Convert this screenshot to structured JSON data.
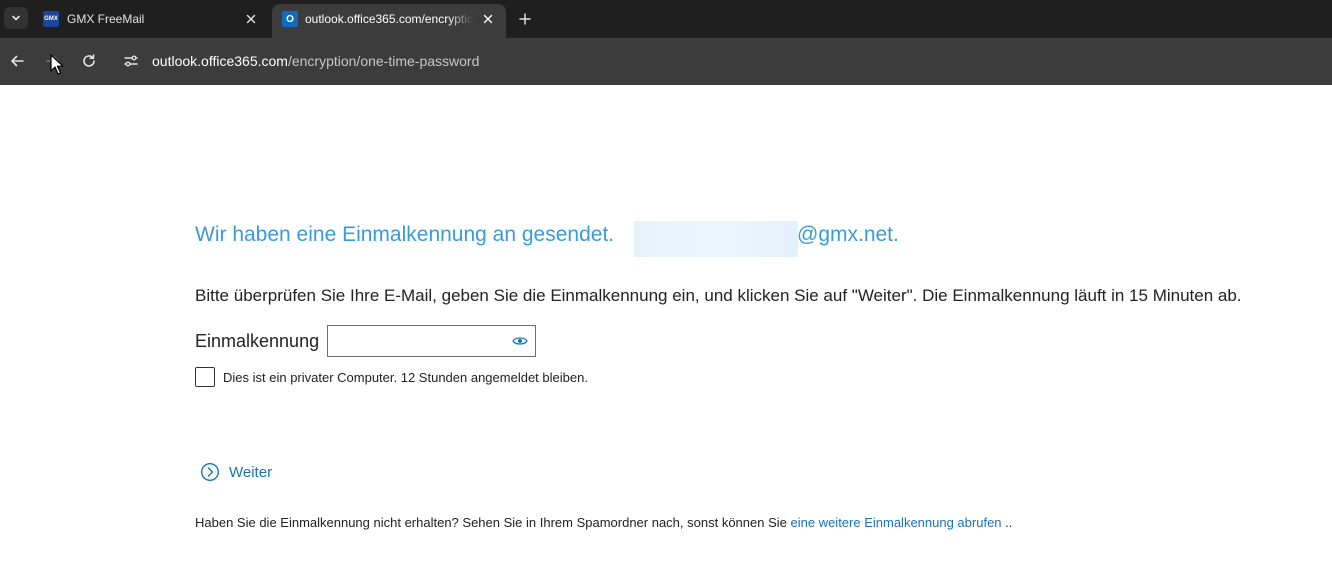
{
  "browser": {
    "tabs": [
      {
        "title": "GMX FreeMail",
        "favicon": "gmx-favicon",
        "favicon_text": "GMX",
        "active": false
      },
      {
        "title": "outlook.office365.com/encryption/one-time-password",
        "favicon": "outlook-favicon",
        "favicon_text": "O",
        "active": true
      }
    ],
    "url_host": "outlook.office365.com",
    "url_path": "/encryption/one-time-password"
  },
  "page": {
    "heading": "Wir haben eine Einmalkennung an gesendet.",
    "heading_email_domain": "@gmx.net.",
    "instructions": "Bitte überprüfen Sie Ihre E-Mail, geben Sie die Einmalkennung ein, und klicken Sie auf \"Weiter\". Die Einmalkennung läuft in 15 Minuten ab.",
    "otp_label": "Einmalkennung",
    "otp_value": "",
    "remember_label": "Dies ist ein privater Computer. 12 Stunden angemeldet bleiben.",
    "next_label": "Weiter",
    "footer_text": "Haben Sie die Einmalkennung nicht erhalten? Sehen Sie in Ihrem Spamordner nach, sonst können Sie ",
    "footer_link": "eine weitere Einmalkennung abrufen",
    "footer_suffix": " .."
  },
  "colors": {
    "heading": "#3a9bd9",
    "link": "#1a73b8",
    "chrome_dark": "#1f1f1f",
    "chrome_toolbar": "#3c3c3c"
  }
}
